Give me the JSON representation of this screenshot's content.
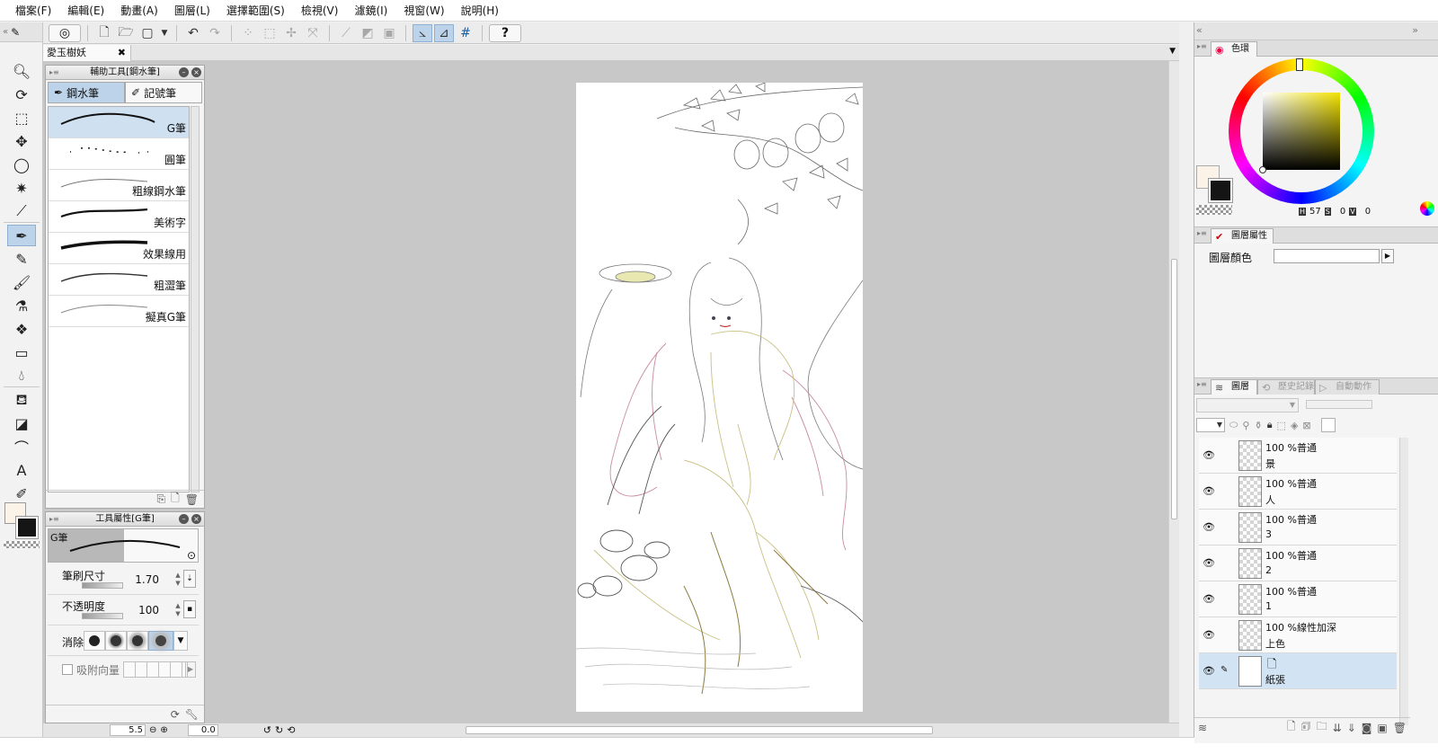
{
  "menu": [
    "檔案(F)",
    "編輯(E)",
    "動畫(A)",
    "圖層(L)",
    "選擇範圍(S)",
    "檢視(V)",
    "濾鏡(I)",
    "視窗(W)",
    "說明(H)"
  ],
  "document": {
    "tab_title": "愛玉樹妖",
    "close": "✖"
  },
  "sub_tool_panel": {
    "title": "輔助工具[鋼水筆]",
    "tabs": [
      "鋼水筆",
      "記號筆"
    ],
    "brushes": [
      "G筆",
      "圓筆",
      "粗線鋼水筆",
      "美術字",
      "效果線用",
      "粗澀筆",
      "擬真G筆"
    ]
  },
  "tool_property_panel": {
    "title": "工具屬性[G筆]",
    "brush_name": "G筆",
    "brush_size_label": "筆刷尺寸",
    "brush_size_value": "1.70",
    "opacity_label": "不透明度",
    "opacity_value": "100",
    "antialias_label": "消除鋸齒",
    "vector_snap_label": "吸附向量"
  },
  "color_panel": {
    "tab_label": "色環",
    "h_label": "H",
    "h": "57",
    "s_label": "S",
    "s": "0",
    "v_label": "V",
    "v": "0"
  },
  "layer_property_panel": {
    "tab_label": "圖層屬性",
    "layer_color_label": "圖層顏色"
  },
  "layer_panel": {
    "tabs": [
      "圖層",
      "歷史記錄",
      "自動動作"
    ],
    "layers": [
      {
        "blend": "100 %普通",
        "name": "景"
      },
      {
        "blend": "100 %普通",
        "name": "人"
      },
      {
        "blend": "100 %普通",
        "name": "3"
      },
      {
        "blend": "100 %普通",
        "name": "2"
      },
      {
        "blend": "100 %普通",
        "name": "1"
      },
      {
        "blend": "100 %線性加深",
        "name": "上色"
      },
      {
        "blend": "",
        "name": "紙張"
      }
    ]
  },
  "status": {
    "zoom": "5.5",
    "angle": "0.0"
  },
  "colors": {
    "main": "#151515",
    "sub": "#fbf3e8",
    "accent": "#bcd3ea"
  }
}
